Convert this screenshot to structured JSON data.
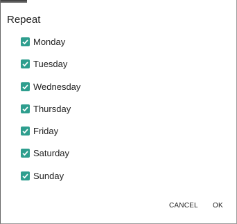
{
  "dialog": {
    "title": "Repeat",
    "accent_color": "#2e9e8e",
    "options": [
      {
        "label": "Monday",
        "checked": true
      },
      {
        "label": "Tuesday",
        "checked": true
      },
      {
        "label": "Wednesday",
        "checked": true
      },
      {
        "label": "Thursday",
        "checked": true
      },
      {
        "label": "Friday",
        "checked": true
      },
      {
        "label": "Saturday",
        "checked": true
      },
      {
        "label": "Sunday",
        "checked": true
      }
    ],
    "actions": {
      "cancel_label": "CANCEL",
      "ok_label": "OK"
    }
  }
}
